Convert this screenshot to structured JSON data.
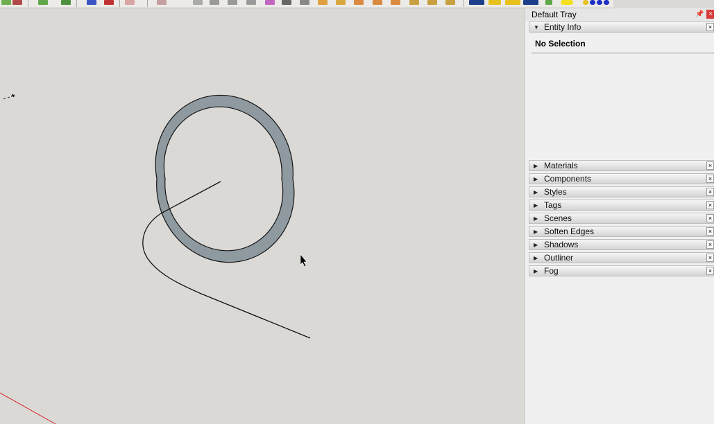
{
  "colors": {
    "viewport_bg": "#dad9d6",
    "ring_fill": "#8f9aa0",
    "red_axis": "#d62020",
    "tray_bg": "#f0f0f0",
    "close_red": "#d83b3b"
  },
  "toolbar": {
    "icons": [
      "toolbar-icon"
    ]
  },
  "tray": {
    "title": "Default Tray",
    "pin_icon": "pin-icon",
    "close_label": "×"
  },
  "entity_info": {
    "label": "Entity Info",
    "expanded": true,
    "status": "No Selection",
    "close_label": "×"
  },
  "panels": [
    {
      "label": "Materials",
      "close_label": "×"
    },
    {
      "label": "Components",
      "close_label": "×"
    },
    {
      "label": "Styles",
      "close_label": "×"
    },
    {
      "label": "Tags",
      "close_label": "×"
    },
    {
      "label": "Scenes",
      "close_label": "×"
    },
    {
      "label": "Soften Edges",
      "close_label": "×"
    },
    {
      "label": "Shadows",
      "close_label": "×"
    },
    {
      "label": "Outliner",
      "close_label": "×"
    },
    {
      "label": "Fog",
      "close_label": "×"
    }
  ]
}
